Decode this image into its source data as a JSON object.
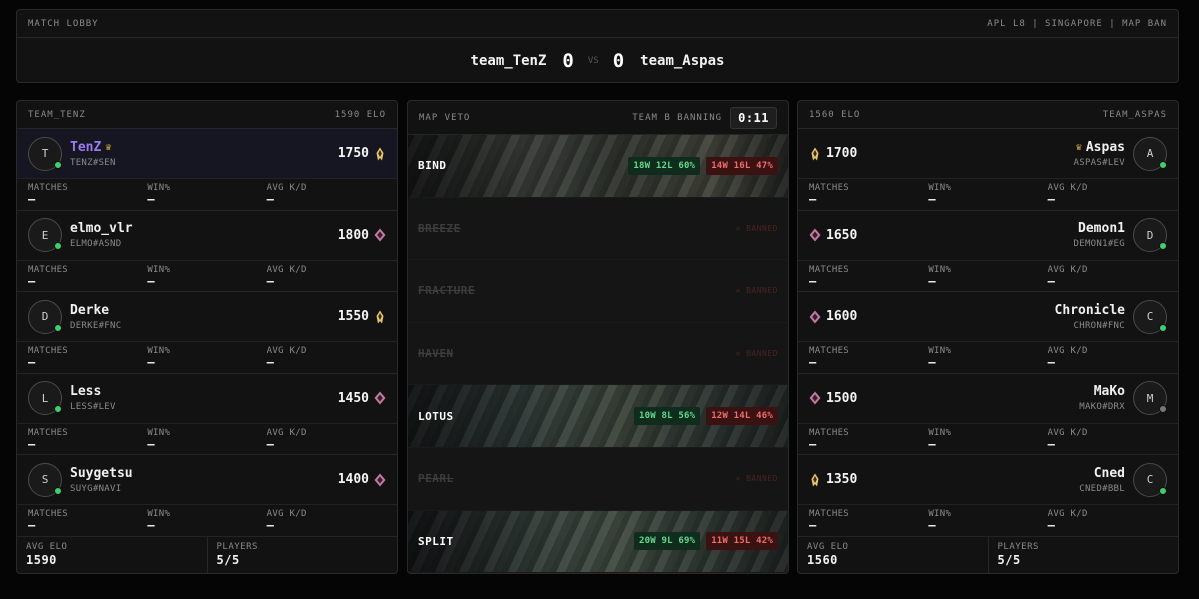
{
  "header": {
    "label": "MATCH LOBBY",
    "meta": "APL L8 | SINGAPORE | MAP BAN",
    "team_a": "team_TenZ",
    "score_a": "0",
    "vs": "VS",
    "score_b": "0",
    "team_b": "team_Aspas"
  },
  "left": {
    "title": "TEAM_TENZ",
    "elo": "1590 ELO",
    "stat_labels": [
      "MATCHES",
      "WIN%",
      "AVG K/D"
    ],
    "players": [
      {
        "initial": "T",
        "name": "TenZ",
        "tag": "TENZ#SEN",
        "elo": "1750",
        "rank": "gold",
        "online": true,
        "leader": true,
        "matches": "–",
        "win": "–",
        "kd": "–"
      },
      {
        "initial": "E",
        "name": "elmo_vlr",
        "tag": "ELMO#ASND",
        "elo": "1800",
        "rank": "pink",
        "online": true,
        "leader": false,
        "matches": "–",
        "win": "–",
        "kd": "–"
      },
      {
        "initial": "D",
        "name": "Derke",
        "tag": "DERKE#FNC",
        "elo": "1550",
        "rank": "gold",
        "online": true,
        "leader": false,
        "matches": "–",
        "win": "–",
        "kd": "–"
      },
      {
        "initial": "L",
        "name": "Less",
        "tag": "LESS#LEV",
        "elo": "1450",
        "rank": "pink",
        "online": true,
        "leader": false,
        "matches": "–",
        "win": "–",
        "kd": "–"
      },
      {
        "initial": "S",
        "name": "Suygetsu",
        "tag": "SUYG#NAVI",
        "elo": "1400",
        "rank": "pink",
        "online": true,
        "leader": false,
        "matches": "–",
        "win": "–",
        "kd": "–"
      }
    ],
    "footer": {
      "avg_label": "AVG ELO",
      "avg": "1590",
      "players_label": "PLAYERS",
      "players": "5/5"
    }
  },
  "right": {
    "title": "TEAM_ASPAS",
    "elo": "1560 ELO",
    "stat_labels": [
      "MATCHES",
      "WIN%",
      "AVG K/D"
    ],
    "players": [
      {
        "initial": "A",
        "name": "Aspas",
        "tag": "ASPAS#LEV",
        "elo": "1700",
        "rank": "gold",
        "online": true,
        "leader": true,
        "matches": "–",
        "win": "–",
        "kd": "–"
      },
      {
        "initial": "D",
        "name": "Demon1",
        "tag": "DEMON1#EG",
        "elo": "1650",
        "rank": "pink",
        "online": true,
        "leader": false,
        "matches": "–",
        "win": "–",
        "kd": "–"
      },
      {
        "initial": "C",
        "name": "Chronicle",
        "tag": "CHRON#FNC",
        "elo": "1600",
        "rank": "pink",
        "online": true,
        "leader": false,
        "matches": "–",
        "win": "–",
        "kd": "–"
      },
      {
        "initial": "M",
        "name": "MaKo",
        "tag": "MAKO#DRX",
        "elo": "1500",
        "rank": "pink",
        "online": false,
        "leader": false,
        "matches": "–",
        "win": "–",
        "kd": "–"
      },
      {
        "initial": "C",
        "name": "Cned",
        "tag": "CNED#BBL",
        "elo": "1350",
        "rank": "gold",
        "online": true,
        "leader": false,
        "matches": "–",
        "win": "–",
        "kd": "–"
      }
    ],
    "footer": {
      "avg_label": "AVG ELO",
      "avg": "1560",
      "players_label": "PLAYERS",
      "players": "5/5"
    }
  },
  "veto": {
    "title": "MAP VETO",
    "status": "TEAM B BANNING",
    "timer": "0:11",
    "banned_label": "BANNED",
    "maps": [
      {
        "name": "BIND",
        "state": "available",
        "style": "bind",
        "rec_a": "18W 12L 60%",
        "rec_b": "14W 16L 47%"
      },
      {
        "name": "BREEZE",
        "state": "banned"
      },
      {
        "name": "FRACTURE",
        "state": "banned"
      },
      {
        "name": "HAVEN",
        "state": "banned"
      },
      {
        "name": "LOTUS",
        "state": "available",
        "style": "lotus",
        "rec_a": "10W 8L 56%",
        "rec_b": "12W 14L 46%"
      },
      {
        "name": "PEARL",
        "state": "banned"
      },
      {
        "name": "SPLIT",
        "state": "available",
        "style": "split",
        "rec_a": "20W 9L 69%",
        "rec_b": "11W 15L 42%"
      }
    ]
  },
  "colors": {
    "online": "#3ecf6e",
    "leader_name": "#9a7cf0",
    "crown": "#d8a642",
    "win_a": "#64d98d",
    "win_b": "#f06d6d"
  },
  "icons": {
    "crown": "crown-icon",
    "rank_gold": "rank-gold-icon",
    "rank_pink": "rank-pink-icon",
    "ban": "ban-x-icon"
  }
}
